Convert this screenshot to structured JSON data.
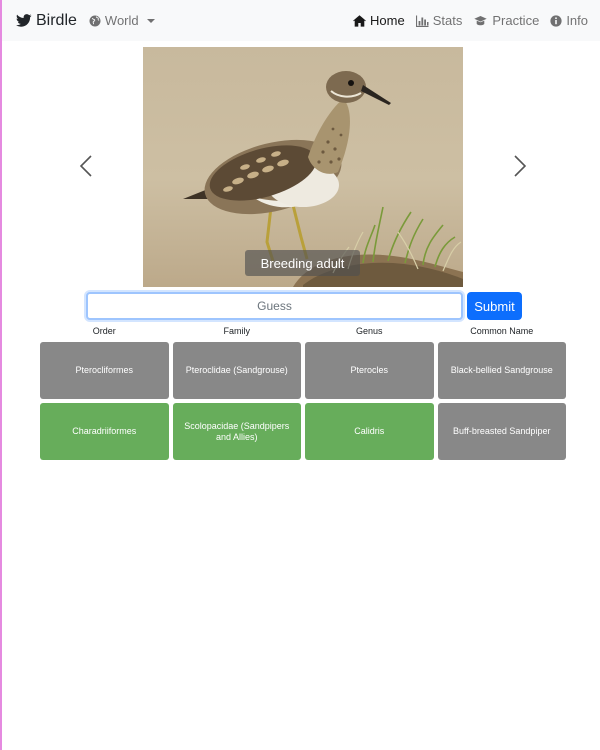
{
  "navbar": {
    "brand": "Birdle",
    "region": "World",
    "links": [
      {
        "label": "Home",
        "icon": "home-icon",
        "active": true
      },
      {
        "label": "Stats",
        "icon": "bar-chart-icon",
        "active": false
      },
      {
        "label": "Practice",
        "icon": "graduation-cap-icon",
        "active": false
      },
      {
        "label": "Info",
        "icon": "info-icon",
        "active": false
      }
    ]
  },
  "carousel": {
    "caption": "Breeding adult",
    "prev_icon": "chevron-left-icon",
    "next_icon": "chevron-right-icon"
  },
  "guess": {
    "placeholder": "Guess",
    "submit_label": "Submit"
  },
  "results": {
    "headers": [
      "Order",
      "Family",
      "Genus",
      "Common Name"
    ],
    "rows": [
      {
        "cells": [
          {
            "text": "Pterocliformes",
            "status": "wrong"
          },
          {
            "text": "Pteroclidae (Sandgrouse)",
            "status": "wrong"
          },
          {
            "text": "Pterocles",
            "status": "wrong"
          },
          {
            "text": "Black-bellied Sandgrouse",
            "status": "wrong"
          }
        ]
      },
      {
        "cells": [
          {
            "text": "Charadriiformes",
            "status": "correct"
          },
          {
            "text": "Scolopacidae (Sandpipers and Allies)",
            "status": "correct"
          },
          {
            "text": "Calidris",
            "status": "correct"
          },
          {
            "text": "Buff-breasted Sandpiper",
            "status": "wrong"
          }
        ]
      }
    ]
  },
  "colors": {
    "correct": "#67ad5b",
    "wrong": "#888888",
    "primary": "#0d6efd",
    "navbar_bg": "#f8f9fa"
  }
}
